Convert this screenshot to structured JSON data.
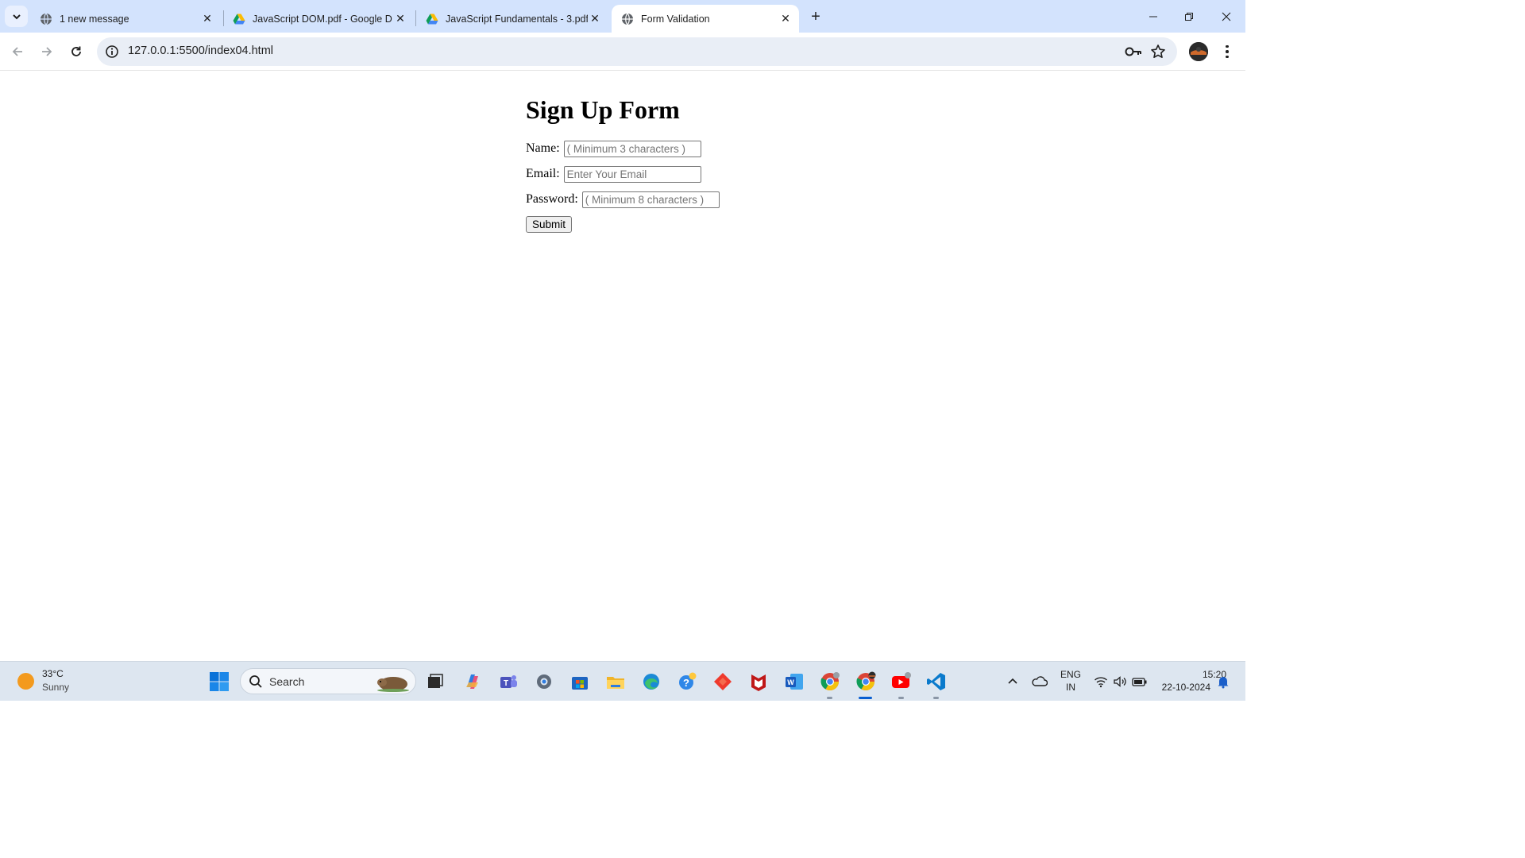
{
  "browser": {
    "tabs": [
      {
        "title": "1 new message",
        "favicon": "globe-icon",
        "active": false
      },
      {
        "title": "JavaScript DOM.pdf - Google D",
        "favicon": "google-drive-icon",
        "active": false
      },
      {
        "title": "JavaScript Fundamentals - 3.pdf",
        "favicon": "google-drive-icon",
        "active": false
      },
      {
        "title": "Form Validation",
        "favicon": "globe-icon",
        "active": true
      }
    ],
    "new_tab_label": "+",
    "url": "127.0.0.1:5500/index04.html"
  },
  "form": {
    "heading": "Sign Up Form",
    "name_label": "Name:",
    "name_placeholder": "( Minimum 3 characters )",
    "email_label": "Email:",
    "email_placeholder": "Enter Your Email",
    "password_label": "Password:",
    "password_placeholder": "( Minimum 8 characters )",
    "submit_label": "Submit"
  },
  "taskbar": {
    "weather_temp": "33°C",
    "weather_desc": "Sunny",
    "search_label": "Search",
    "lang_line1": "ENG",
    "lang_line2": "IN",
    "time": "15:20",
    "date": "22-10-2024"
  },
  "colors": {
    "tabstrip_bg": "#d3e3fd",
    "omnibox_bg": "#e9eef6",
    "taskbar_bg": "#dde6f0",
    "accent": "#0a5fd1"
  }
}
